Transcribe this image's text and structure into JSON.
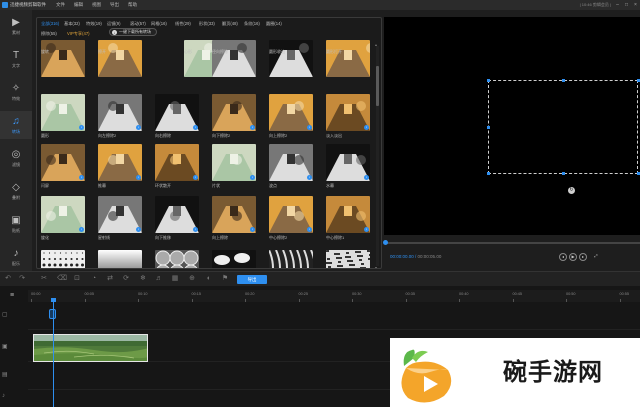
{
  "titlebar": {
    "app_name": "迅捷视频剪辑软件",
    "menu": [
      "文件",
      "编辑",
      "视图",
      "导出",
      "帮助"
    ],
    "right_text": "| 10:46 剪辑会员 |"
  },
  "rail": [
    {
      "label": "素材",
      "icon": "film-icon",
      "glyph": "▶"
    },
    {
      "label": "文字",
      "icon": "text-icon",
      "glyph": "T"
    },
    {
      "label": "特效",
      "icon": "effects-icon",
      "glyph": "✧"
    },
    {
      "label": "转场",
      "icon": "transition-icon",
      "glyph": "♫",
      "active": true
    },
    {
      "label": "滤镜",
      "icon": "filter-icon",
      "glyph": "◎"
    },
    {
      "label": "叠附",
      "icon": "layers-icon",
      "glyph": "◇"
    },
    {
      "label": "贴纸",
      "icon": "sticker-icon",
      "glyph": "▣"
    },
    {
      "label": "配乐",
      "icon": "music-icon",
      "glyph": "♪"
    }
  ],
  "tabs": [
    {
      "label": "全部(316)",
      "active": true
    },
    {
      "label": "基本(32)"
    },
    {
      "label": "特效(19)"
    },
    {
      "label": "运镜(9)"
    },
    {
      "label": "滚动(57)"
    },
    {
      "label": "网格(16)"
    },
    {
      "label": "线性(29)"
    },
    {
      "label": "形状(33)"
    },
    {
      "label": "翻页(48)"
    },
    {
      "label": "条纹(16)"
    },
    {
      "label": "圆圈(14)"
    },
    {
      "label": "擦除(55)"
    },
    {
      "label": "VIP专享(47)",
      "vip": true
    }
  ],
  "download_button": "一键下载所有转场",
  "transitions": [
    [
      "旋转",
      "擦开",
      "",
      "心形",
      "径向擦除",
      "圆形收边",
      "",
      "圆形打开"
    ],
    [
      "圆形",
      "向左擦除2",
      "向右擦除",
      "向下擦除2",
      "向上擦除2",
      "淡入淡出"
    ],
    [
      "闪屏",
      "推幕",
      "环状散开",
      "片状",
      "波点",
      "水幕"
    ],
    [
      "旋化",
      "星射线",
      "向下推移",
      "向上擦除",
      "中心擦除2",
      "中心擦除1"
    ],
    [
      "",
      "",
      "",
      "",
      "",
      ""
    ]
  ],
  "preview": {
    "current_time": "00:00:00.00",
    "total_time": "00:00:05.00",
    "progress": 0
  },
  "toolbar": {
    "export_label": "导出"
  },
  "timeline": {
    "ruler": [
      "00:00",
      "00:05",
      "00:10",
      "00:15",
      "00:20",
      "00:25",
      "00:30",
      "00:35",
      "00:40",
      "00:45",
      "00:50",
      "00:55",
      "01:00",
      "01:05",
      "01:10"
    ],
    "tracks": [
      "",
      "",
      "",
      ""
    ]
  },
  "watermark": {
    "text": "碗手游网"
  }
}
